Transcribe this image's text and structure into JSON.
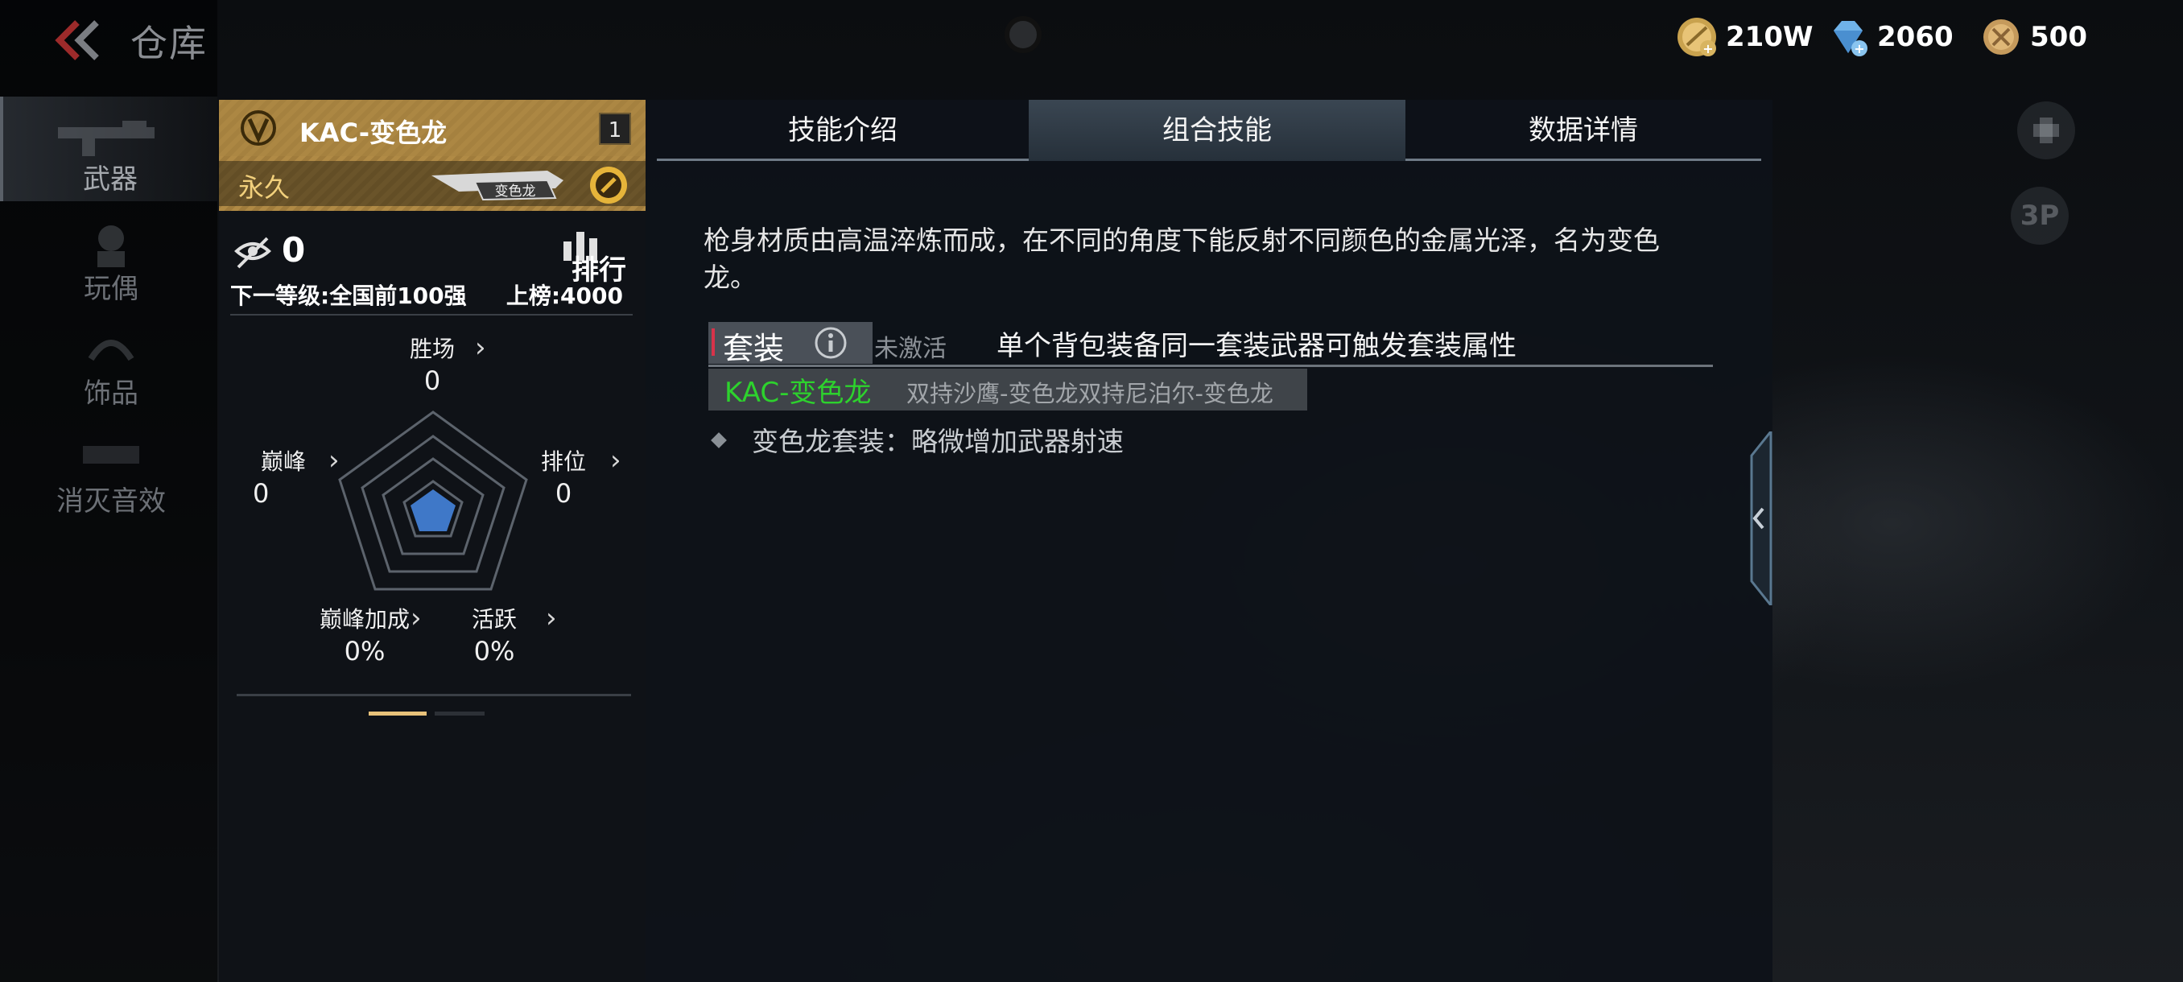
{
  "header": {
    "title": "仓库",
    "currencies": [
      {
        "name": "gold",
        "value": "210W"
      },
      {
        "name": "diamond",
        "value": "2060"
      },
      {
        "name": "coin",
        "value": "500"
      }
    ]
  },
  "nav": {
    "items": [
      {
        "label": "武器"
      },
      {
        "label": "玩偶"
      },
      {
        "label": "饰品"
      },
      {
        "label": "消灭音效"
      }
    ]
  },
  "card": {
    "weapon_name": "KAC-变色龙",
    "level": "1",
    "duration": "永久",
    "rank_value": "0",
    "leaderboard_label": "排行",
    "next_level": "下一等级:全国前100强",
    "threshold": "上榜:4000",
    "stats": {
      "wins": {
        "label": "胜场",
        "value": "0"
      },
      "peak": {
        "label": "巅峰",
        "value": "0"
      },
      "rank": {
        "label": "排位",
        "value": "0"
      },
      "peak_bonus": {
        "label": "巅峰加成",
        "value": "0%"
      },
      "active": {
        "label": "活跃",
        "value": "0%"
      }
    }
  },
  "panel": {
    "tabs": [
      {
        "label": "技能介绍"
      },
      {
        "label": "组合技能"
      },
      {
        "label": "数据详情"
      }
    ],
    "description": "枪身材质由高温淬炼而成，在不同的角度下能反射不同颜色的金属光泽，名为变色龙。",
    "set": {
      "label": "套装",
      "status": "未激活",
      "note": "单个背包装备同一套装武器可触发套装属性",
      "main_item": "KAC-变色龙",
      "other_items": "双持沙鹰-变色龙双持尼泊尔-变色龙",
      "bonus": "变色龙套装：略微增加武器射速"
    }
  }
}
